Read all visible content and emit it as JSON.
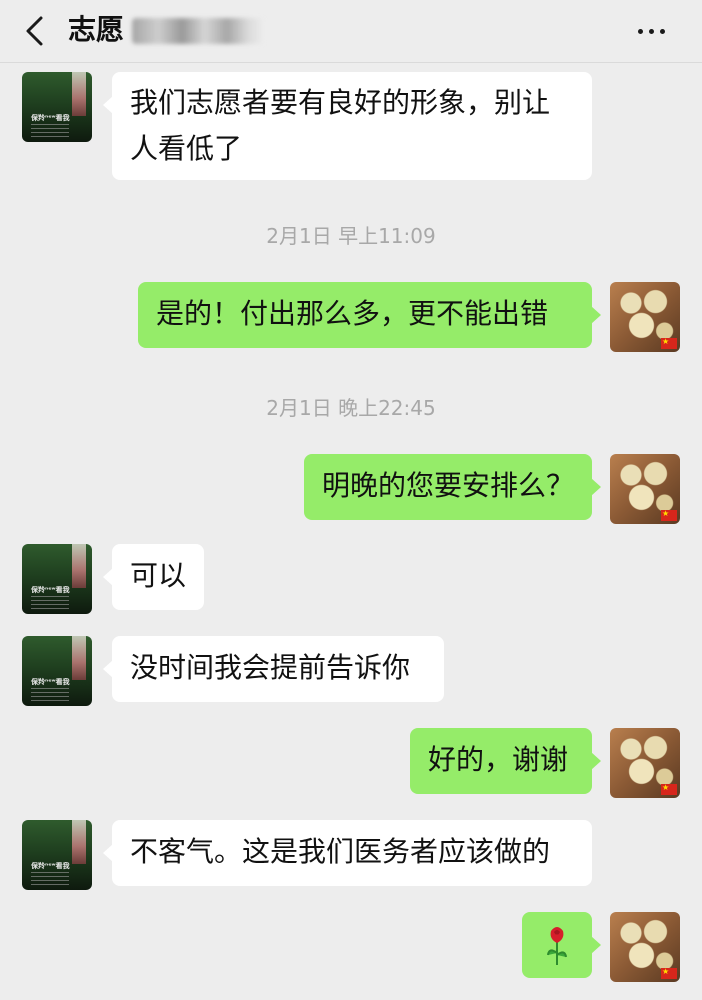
{
  "header": {
    "title": "志愿",
    "icons": {
      "back": "chevron-left-icon",
      "more": "more-dots-icon"
    }
  },
  "messages": [
    {
      "side": "left",
      "text_lines": [
        "我们志愿者要有良好的形象，别让",
        "人看低了"
      ]
    },
    {
      "type": "timestamp",
      "text": "2月1日 早上11:09"
    },
    {
      "side": "right",
      "text": "是的！付出那么多，更不能出错"
    },
    {
      "type": "timestamp",
      "text": "2月1日 晚上22:45"
    },
    {
      "side": "right",
      "text": "明晚的您要安排么？"
    },
    {
      "side": "left",
      "text": "可以"
    },
    {
      "side": "left",
      "text": "没时间我会提前告诉你"
    },
    {
      "side": "right",
      "text": "好的，谢谢"
    },
    {
      "side": "left",
      "text": "不客气。这是我们医务者应该做的"
    },
    {
      "side": "right",
      "emoji": "rose-icon"
    }
  ],
  "avatars": {
    "left_label": "保羚ⁿᵉʷ看我"
  },
  "colors": {
    "background": "#ededed",
    "sent_bubble": "#95ec69",
    "received_bubble": "#ffffff",
    "timestamp": "#a8a8a8"
  }
}
